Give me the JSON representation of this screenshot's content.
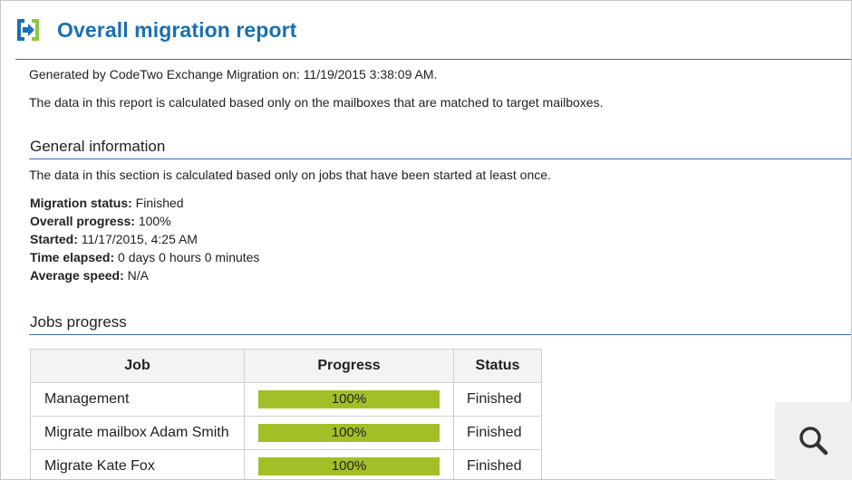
{
  "colors": {
    "accent": "#1b6fb2",
    "logo_blue": "#1b6fb2",
    "logo_green": "#8cc63f",
    "progress_bar": "#a3bf27",
    "search_tile": "#efefef"
  },
  "report": {
    "title": "Overall migration report",
    "generated": "Generated by CodeTwo Exchange Migration on: 11/19/2015 3:38:09 AM.",
    "scope_note": "The data in this report is calculated based only on the mailboxes that are matched to target mailboxes."
  },
  "general": {
    "heading": "General information",
    "note": "The data in this section is calculated based only on jobs that have been started at least once.",
    "fields": [
      {
        "label": "Migration status:",
        "value": "Finished"
      },
      {
        "label": "Overall progress:",
        "value": "100%"
      },
      {
        "label": "Started:",
        "value": "11/17/2015, 4:25 AM"
      },
      {
        "label": "Time elapsed:",
        "value": "0 days 0 hours 0 minutes"
      },
      {
        "label": "Average speed:",
        "value": "N/A"
      }
    ]
  },
  "jobs": {
    "heading": "Jobs progress",
    "columns": [
      "Job",
      "Progress",
      "Status"
    ],
    "rows": [
      {
        "job": "Management",
        "progress": "100%",
        "status": "Finished"
      },
      {
        "job": "Migrate mailbox Adam Smith",
        "progress": "100%",
        "status": "Finished"
      },
      {
        "job": "Migrate Kate Fox",
        "progress": "100%",
        "status": "Finished"
      }
    ]
  },
  "icons": {
    "logo": "codetwo-logo-icon",
    "search": "search-icon"
  }
}
